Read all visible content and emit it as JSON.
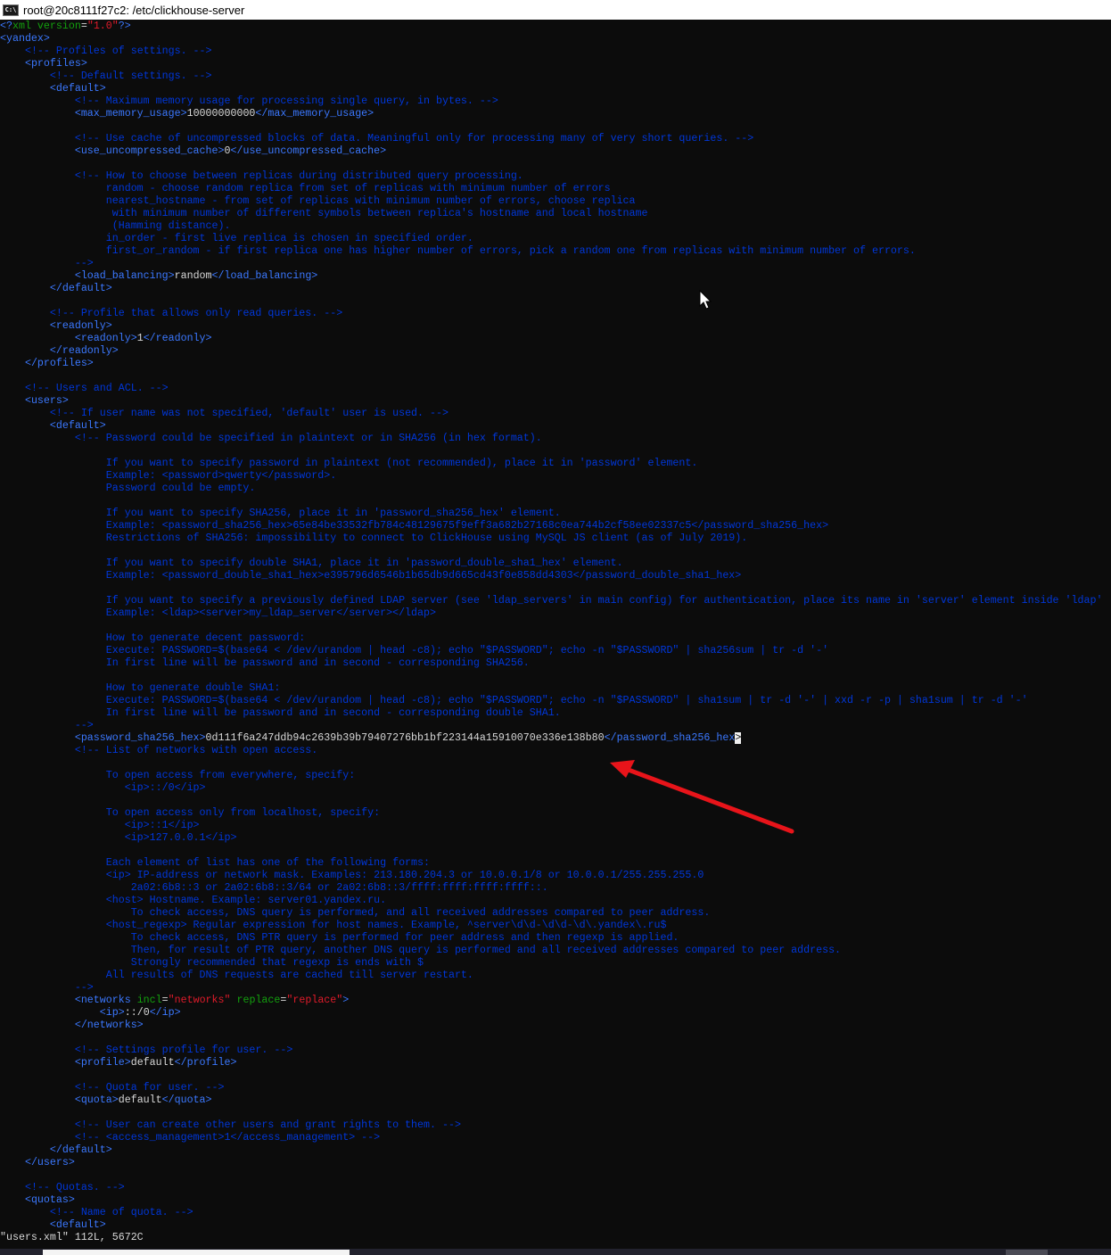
{
  "window": {
    "title": "root@20c8111f27c2: /etc/clickhouse-server",
    "icon": "cmd-icon",
    "icon_text": "C:\\"
  },
  "colors": {
    "background": "#0c0c0c",
    "tag": "#3b78ff",
    "comment": "#0037da",
    "attribute": "#13a10e",
    "value": "#e01b2a",
    "text": "#d8d8d8",
    "annotation_arrow": "#e8141a"
  },
  "editor": {
    "lines": [
      [
        [
          "t",
          "<?"
        ],
        [
          "a",
          "xml version"
        ],
        [
          "w",
          "="
        ],
        [
          "v",
          "\"1.0\""
        ],
        [
          "t",
          "?>"
        ]
      ],
      [
        [
          "t",
          "<yandex>"
        ]
      ],
      [
        [
          "w",
          "    "
        ],
        [
          "c",
          "<!-- Profiles of settings. -->"
        ]
      ],
      [
        [
          "w",
          "    "
        ],
        [
          "t",
          "<profiles>"
        ]
      ],
      [
        [
          "w",
          "        "
        ],
        [
          "c",
          "<!-- Default settings. -->"
        ]
      ],
      [
        [
          "w",
          "        "
        ],
        [
          "t",
          "<default>"
        ]
      ],
      [
        [
          "w",
          "            "
        ],
        [
          "c",
          "<!-- Maximum memory usage for processing single query, in bytes. -->"
        ]
      ],
      [
        [
          "w",
          "            "
        ],
        [
          "t",
          "<max_memory_usage>"
        ],
        [
          "w",
          "10000000000"
        ],
        [
          "t",
          "</max_memory_usage>"
        ]
      ],
      [],
      [
        [
          "w",
          "            "
        ],
        [
          "c",
          "<!-- Use cache of uncompressed blocks of data. Meaningful only for processing many of very short queries. -->"
        ]
      ],
      [
        [
          "w",
          "            "
        ],
        [
          "t",
          "<use_uncompressed_cache>"
        ],
        [
          "w",
          "0"
        ],
        [
          "t",
          "</use_uncompressed_cache>"
        ]
      ],
      [],
      [
        [
          "w",
          "            "
        ],
        [
          "c",
          "<!-- How to choose between replicas during distributed query processing."
        ]
      ],
      [
        [
          "c",
          "                 random - choose random replica from set of replicas with minimum number of errors"
        ]
      ],
      [
        [
          "c",
          "                 nearest_hostname - from set of replicas with minimum number of errors, choose replica"
        ]
      ],
      [
        [
          "c",
          "                  with minimum number of different symbols between replica's hostname and local hostname"
        ]
      ],
      [
        [
          "c",
          "                  (Hamming distance)."
        ]
      ],
      [
        [
          "c",
          "                 in_order - first live replica is chosen in specified order."
        ]
      ],
      [
        [
          "c",
          "                 first_or_random - if first replica one has higher number of errors, pick a random one from replicas with minimum number of errors."
        ]
      ],
      [
        [
          "c",
          "            -->"
        ]
      ],
      [
        [
          "w",
          "            "
        ],
        [
          "t",
          "<load_balancing>"
        ],
        [
          "w",
          "random"
        ],
        [
          "t",
          "</load_balancing>"
        ]
      ],
      [
        [
          "w",
          "        "
        ],
        [
          "t",
          "</default>"
        ]
      ],
      [],
      [
        [
          "w",
          "        "
        ],
        [
          "c",
          "<!-- Profile that allows only read queries. -->"
        ]
      ],
      [
        [
          "w",
          "        "
        ],
        [
          "t",
          "<readonly>"
        ]
      ],
      [
        [
          "w",
          "            "
        ],
        [
          "t",
          "<readonly>"
        ],
        [
          "w",
          "1"
        ],
        [
          "t",
          "</readonly>"
        ]
      ],
      [
        [
          "w",
          "        "
        ],
        [
          "t",
          "</readonly>"
        ]
      ],
      [
        [
          "w",
          "    "
        ],
        [
          "t",
          "</profiles>"
        ]
      ],
      [],
      [
        [
          "w",
          "    "
        ],
        [
          "c",
          "<!-- Users and ACL. -->"
        ]
      ],
      [
        [
          "w",
          "    "
        ],
        [
          "t",
          "<users>"
        ]
      ],
      [
        [
          "w",
          "        "
        ],
        [
          "c",
          "<!-- If user name was not specified, 'default' user is used. -->"
        ]
      ],
      [
        [
          "w",
          "        "
        ],
        [
          "t",
          "<default>"
        ]
      ],
      [
        [
          "w",
          "            "
        ],
        [
          "c",
          "<!-- Password could be specified in plaintext or in SHA256 (in hex format)."
        ]
      ],
      [],
      [
        [
          "c",
          "                 If you want to specify password in plaintext (not recommended), place it in 'password' element."
        ]
      ],
      [
        [
          "c",
          "                 Example: <password>qwerty</password>."
        ]
      ],
      [
        [
          "c",
          "                 Password could be empty."
        ]
      ],
      [],
      [
        [
          "c",
          "                 If you want to specify SHA256, place it in 'password_sha256_hex' element."
        ]
      ],
      [
        [
          "c",
          "                 Example: <password_sha256_hex>65e84be33532fb784c48129675f9eff3a682b27168c0ea744b2cf58ee02337c5</password_sha256_hex>"
        ]
      ],
      [
        [
          "c",
          "                 Restrictions of SHA256: impossibility to connect to ClickHouse using MySQL JS client (as of July 2019)."
        ]
      ],
      [],
      [
        [
          "c",
          "                 If you want to specify double SHA1, place it in 'password_double_sha1_hex' element."
        ]
      ],
      [
        [
          "c",
          "                 Example: <password_double_sha1_hex>e395796d6546b1b65db9d665cd43f0e858dd4303</password_double_sha1_hex>"
        ]
      ],
      [],
      [
        [
          "c",
          "                 If you want to specify a previously defined LDAP server (see 'ldap_servers' in main config) for authentication, place its name in 'server' element inside 'ldap'"
        ]
      ],
      [
        [
          "c",
          "                 Example: <ldap><server>my_ldap_server</server></ldap>"
        ]
      ],
      [],
      [
        [
          "c",
          "                 How to generate decent password:"
        ]
      ],
      [
        [
          "c",
          "                 Execute: PASSWORD=$(base64 < /dev/urandom | head -c8); echo \"$PASSWORD\"; echo -n \"$PASSWORD\" | sha256sum | tr -d '-'"
        ]
      ],
      [
        [
          "c",
          "                 In first line will be password and in second - corresponding SHA256."
        ]
      ],
      [],
      [
        [
          "c",
          "                 How to generate double SHA1:"
        ]
      ],
      [
        [
          "c",
          "                 Execute: PASSWORD=$(base64 < /dev/urandom | head -c8); echo \"$PASSWORD\"; echo -n \"$PASSWORD\" | sha1sum | tr -d '-' | xxd -r -p | sha1sum | tr -d '-'"
        ]
      ],
      [
        [
          "c",
          "                 In first line will be password and in second - corresponding double SHA1."
        ]
      ],
      [
        [
          "c",
          "            -->"
        ]
      ],
      [
        [
          "w",
          "            "
        ],
        [
          "t",
          "<password_sha256_hex>"
        ],
        [
          "w",
          "0d111f6a247ddb94c2639b39b79407276bb1bf223144a15910070e336e138b80"
        ],
        [
          "t",
          "</password_sha256_hex"
        ],
        [
          "cur",
          ">"
        ]
      ],
      [
        [
          "w",
          "            "
        ],
        [
          "c",
          "<!-- List of networks with open access."
        ]
      ],
      [],
      [
        [
          "c",
          "                 To open access from everywhere, specify:"
        ]
      ],
      [
        [
          "c",
          "                    <ip>::/0</ip>"
        ]
      ],
      [],
      [
        [
          "c",
          "                 To open access only from localhost, specify:"
        ]
      ],
      [
        [
          "c",
          "                    <ip>::1</ip>"
        ]
      ],
      [
        [
          "c",
          "                    <ip>127.0.0.1</ip>"
        ]
      ],
      [],
      [
        [
          "c",
          "                 Each element of list has one of the following forms:"
        ]
      ],
      [
        [
          "c",
          "                 <ip> IP-address or network mask. Examples: 213.180.204.3 or 10.0.0.1/8 or 10.0.0.1/255.255.255.0"
        ]
      ],
      [
        [
          "c",
          "                     2a02:6b8::3 or 2a02:6b8::3/64 or 2a02:6b8::3/ffff:ffff:ffff:ffff::."
        ]
      ],
      [
        [
          "c",
          "                 <host> Hostname. Example: server01.yandex.ru."
        ]
      ],
      [
        [
          "c",
          "                     To check access, DNS query is performed, and all received addresses compared to peer address."
        ]
      ],
      [
        [
          "c",
          "                 <host_regexp> Regular expression for host names. Example, ^server\\d\\d-\\d\\d-\\d\\.yandex\\.ru$"
        ]
      ],
      [
        [
          "c",
          "                     To check access, DNS PTR query is performed for peer address and then regexp is applied."
        ]
      ],
      [
        [
          "c",
          "                     Then, for result of PTR query, another DNS query is performed and all received addresses compared to peer address."
        ]
      ],
      [
        [
          "c",
          "                     Strongly recommended that regexp is ends with $"
        ]
      ],
      [
        [
          "c",
          "                 All results of DNS requests are cached till server restart."
        ]
      ],
      [
        [
          "c",
          "            -->"
        ]
      ],
      [
        [
          "w",
          "            "
        ],
        [
          "t",
          "<networks "
        ],
        [
          "a",
          "incl"
        ],
        [
          "w",
          "="
        ],
        [
          "v",
          "\"networks\""
        ],
        [
          "a",
          " replace"
        ],
        [
          "w",
          "="
        ],
        [
          "v",
          "\"replace\""
        ],
        [
          "t",
          ">"
        ]
      ],
      [
        [
          "w",
          "                "
        ],
        [
          "t",
          "<ip>"
        ],
        [
          "w",
          "::/0"
        ],
        [
          "t",
          "</ip>"
        ]
      ],
      [
        [
          "w",
          "            "
        ],
        [
          "t",
          "</networks>"
        ]
      ],
      [],
      [
        [
          "w",
          "            "
        ],
        [
          "c",
          "<!-- Settings profile for user. -->"
        ]
      ],
      [
        [
          "w",
          "            "
        ],
        [
          "t",
          "<profile>"
        ],
        [
          "w",
          "default"
        ],
        [
          "t",
          "</profile>"
        ]
      ],
      [],
      [
        [
          "w",
          "            "
        ],
        [
          "c",
          "<!-- Quota for user. -->"
        ]
      ],
      [
        [
          "w",
          "            "
        ],
        [
          "t",
          "<quota>"
        ],
        [
          "w",
          "default"
        ],
        [
          "t",
          "</quota>"
        ]
      ],
      [],
      [
        [
          "w",
          "            "
        ],
        [
          "c",
          "<!-- User can create other users and grant rights to them. -->"
        ]
      ],
      [
        [
          "w",
          "            "
        ],
        [
          "c",
          "<!-- <access_management>1</access_management> -->"
        ]
      ],
      [
        [
          "w",
          "        "
        ],
        [
          "t",
          "</default>"
        ]
      ],
      [
        [
          "w",
          "    "
        ],
        [
          "t",
          "</users>"
        ]
      ],
      [],
      [
        [
          "w",
          "    "
        ],
        [
          "c",
          "<!-- Quotas. -->"
        ]
      ],
      [
        [
          "w",
          "    "
        ],
        [
          "t",
          "<quotas>"
        ]
      ],
      [
        [
          "w",
          "        "
        ],
        [
          "c",
          "<!-- Name of quota. -->"
        ]
      ],
      [
        [
          "w",
          "        "
        ],
        [
          "t",
          "<default>"
        ]
      ]
    ],
    "status_line": "\"users.xml\" 112L, 5672C"
  }
}
